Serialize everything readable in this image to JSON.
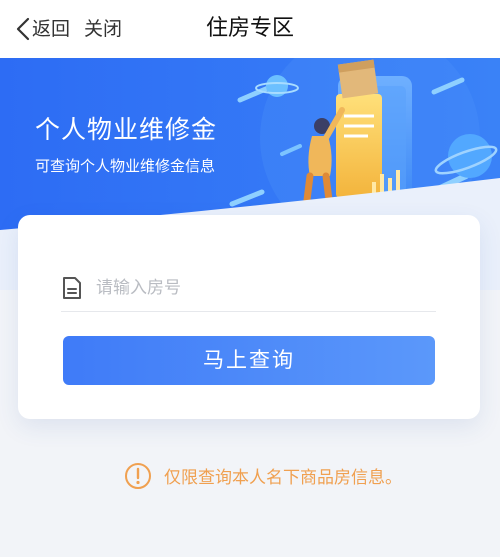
{
  "navbar": {
    "back_label": "返回",
    "close_label": "关闭",
    "title": "住房专区"
  },
  "banner": {
    "title": "个人物业维修金",
    "subtitle": "可查询个人物业维修金信息"
  },
  "form": {
    "room_input": {
      "value": "",
      "placeholder": "请输入房号"
    },
    "submit_label": "马上查询"
  },
  "notice": {
    "text": "仅限查询本人名下商品房信息。"
  },
  "colors": {
    "primary": "#3f7bf8",
    "banner_bg": "#2f6ff5",
    "notice": "#f0a050"
  },
  "icons": {
    "back": "chevron-left-icon",
    "document": "document-icon",
    "notice": "exclamation-circle-icon"
  }
}
